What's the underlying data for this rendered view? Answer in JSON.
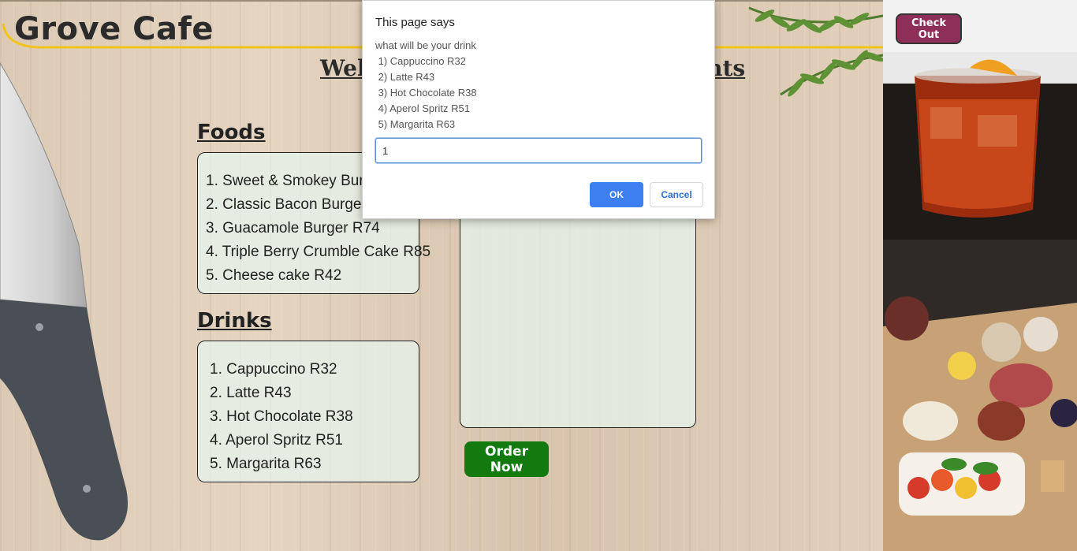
{
  "header": {
    "logo": "Grove Cafe",
    "welcome_left": "Wel",
    "welcome_right": "ants"
  },
  "foods": {
    "title": "Foods",
    "items": [
      "1. Sweet & Smokey Burg",
      "2. Classic Bacon Burger R",
      "3. Guacamole Burger R74",
      "4. Triple Berry Crumble Cake R85",
      "5. Cheese cake R42"
    ]
  },
  "drinks": {
    "title": "Drinks",
    "items": [
      "1. Cappuccino R32",
      "2. Latte R43",
      "3. Hot Chocolate R38",
      "4. Aperol Spritz R51",
      "5. Margarita R63"
    ]
  },
  "order": {
    "button_label": "Order Now"
  },
  "checkout": {
    "button_label": "Check Out"
  },
  "dialog": {
    "title": "This page says",
    "message_lines": [
      "what will be your drink",
      " 1) Cappuccino R32",
      " 2) Latte R43",
      " 3) Hot Chocolate R38",
      " 4) Aperol Spritz R51",
      " 5) Margarita R63"
    ],
    "input_value": "1",
    "ok_label": "OK",
    "cancel_label": "Cancel"
  },
  "colors": {
    "accent_yellow": "#f2c318",
    "order_green": "#127a0e",
    "checkout_plum": "#8e2f5a",
    "dialog_blue": "#3d7ef0"
  },
  "icons": [
    "knife-image",
    "rosemary-image",
    "cocktail-photo",
    "platter-photo"
  ]
}
